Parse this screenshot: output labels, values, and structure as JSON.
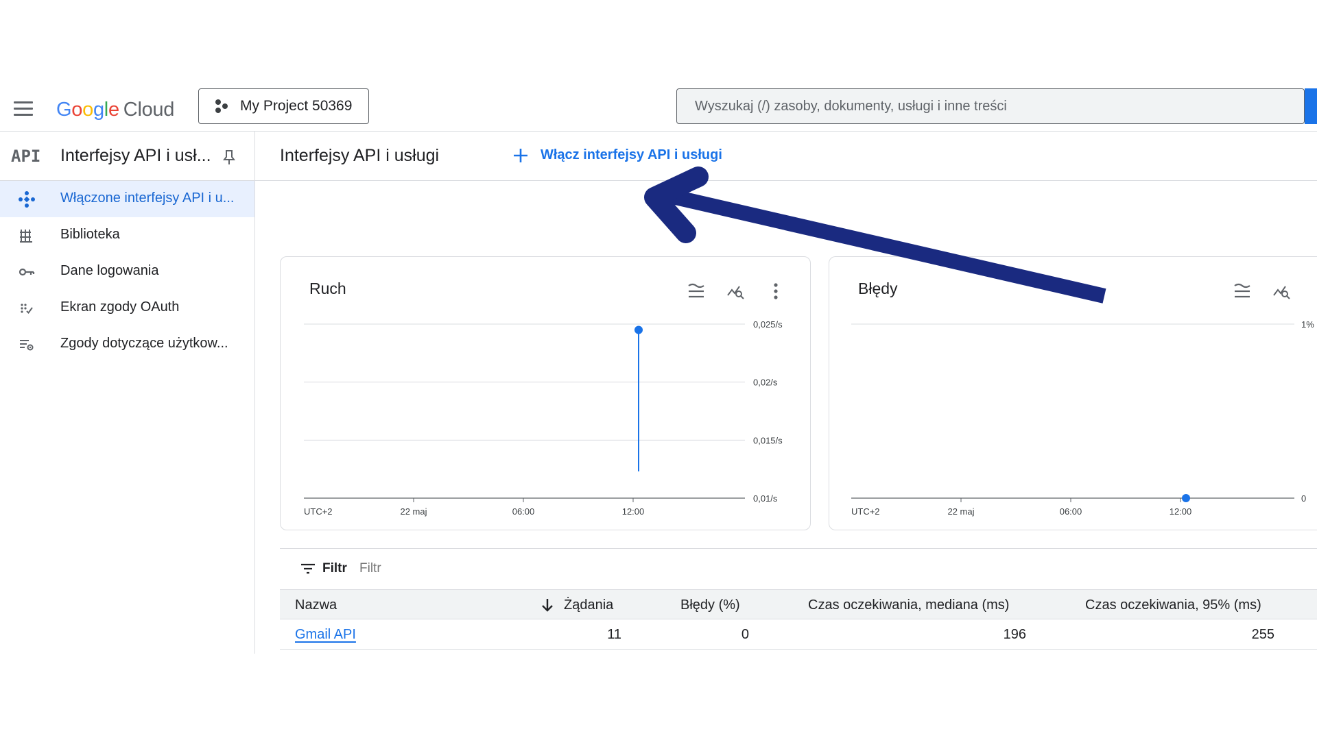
{
  "header": {
    "logo_google": "Google",
    "logo_cloud": "Cloud",
    "project_label": "My Project 50369",
    "search_placeholder": "Wyszukaj (/) zasoby, dokumenty, usługi i inne treści"
  },
  "sidebar": {
    "badge": "API",
    "title": "Interfejsy API i usł...",
    "items": [
      {
        "label": "Włączone interfejsy API i u...",
        "icon": "api-nodes-icon",
        "active": true
      },
      {
        "label": "Biblioteka",
        "icon": "library-icon",
        "active": false
      },
      {
        "label": "Dane logowania",
        "icon": "key-icon",
        "active": false
      },
      {
        "label": "Ekran zgody OAuth",
        "icon": "oauth-consent-icon",
        "active": false
      },
      {
        "label": "Zgody dotyczące użytkow...",
        "icon": "user-consent-settings-icon",
        "active": false
      }
    ]
  },
  "main": {
    "title": "Interfejsy API i usługi",
    "enable_label": "Włącz interfejsy API i usługi"
  },
  "chart_data": [
    {
      "type": "line",
      "title": "Ruch",
      "x_ticks": [
        "UTC+2",
        "22 maj",
        "06:00",
        "12:00"
      ],
      "y_ticks": [
        "0,025/s",
        "0,02/s",
        "0,015/s",
        "0,01/s"
      ],
      "ylim": [
        0.01,
        0.025
      ],
      "series": [
        {
          "values": [
            {
              "x": "12:00",
              "y": 0.0245
            },
            {
              "x": "12:00",
              "y": 0.0123
            }
          ]
        }
      ]
    },
    {
      "type": "line",
      "title": "Błędy",
      "x_ticks": [
        "UTC+2",
        "22 maj",
        "06:00",
        "12:00"
      ],
      "y_ticks": [
        "1%",
        "0"
      ],
      "ylim": [
        0,
        1
      ],
      "series": [
        {
          "values": [
            {
              "x": "12:00",
              "y": 0
            }
          ]
        }
      ]
    }
  ],
  "table": {
    "filter_label": "Filtr",
    "filter_placeholder": "Filtr",
    "columns": [
      "Nazwa",
      "Żądania",
      "Błędy (%)",
      "Czas oczekiwania, mediana (ms)",
      "Czas oczekiwania, 95% (ms)"
    ],
    "rows": [
      {
        "name": "Gmail API",
        "requests": "11",
        "errors": "0",
        "median": "196",
        "p95": "255"
      }
    ]
  },
  "colors": {
    "accent": "#1a73e8",
    "active_bg": "#e8f0fe",
    "annotation_arrow": "#1a2a80"
  }
}
